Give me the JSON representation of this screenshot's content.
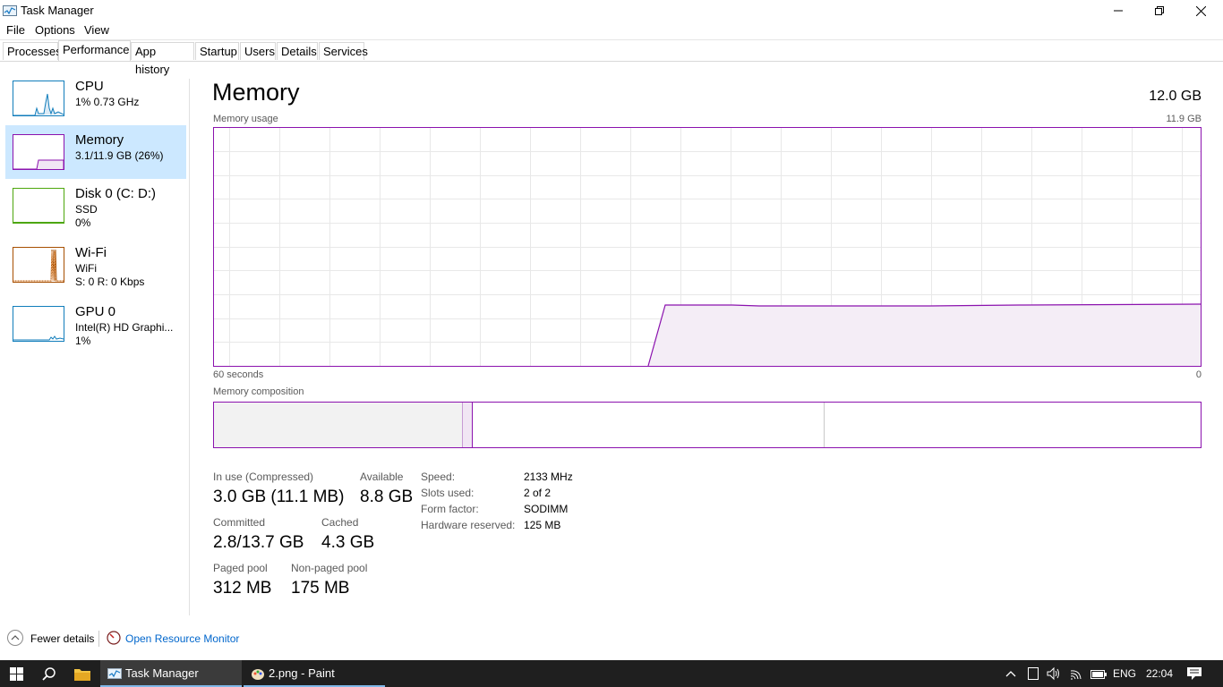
{
  "window": {
    "title": "Task Manager"
  },
  "menu": {
    "items": [
      "File",
      "Options",
      "View"
    ]
  },
  "tabs": [
    {
      "label": "Processes"
    },
    {
      "label": "Performance"
    },
    {
      "label": "App history"
    },
    {
      "label": "Startup"
    },
    {
      "label": "Users"
    },
    {
      "label": "Details"
    },
    {
      "label": "Services"
    }
  ],
  "sidebar": {
    "cpu": {
      "title": "CPU",
      "line1": "1% 0.73 GHz"
    },
    "memory": {
      "title": "Memory",
      "line1": "3.1/11.9 GB (26%)"
    },
    "disk": {
      "title": "Disk 0 (C: D:)",
      "line1": "SSD",
      "line2": "0%"
    },
    "wifi": {
      "title": "Wi-Fi",
      "line1": "WiFi",
      "line2": "S: 0 R: 0 Kbps"
    },
    "gpu": {
      "title": "GPU 0",
      "line1": "Intel(R) HD Graphi...",
      "line2": "1%"
    }
  },
  "main": {
    "title": "Memory",
    "total": "12.0 GB",
    "usage_label": "Memory usage",
    "usage_max": "11.9 GB",
    "time_left": "60 seconds",
    "time_right": "0",
    "composition_label": "Memory composition",
    "stats": {
      "in_use_label": "In use (Compressed)",
      "in_use_value": "3.0 GB (11.1 MB)",
      "available_label": "Available",
      "available_value": "8.8 GB",
      "committed_label": "Committed",
      "committed_value": "2.8/13.7 GB",
      "cached_label": "Cached",
      "cached_value": "4.3 GB",
      "paged_label": "Paged pool",
      "paged_value": "312 MB",
      "nonpaged_label": "Non-paged pool",
      "nonpaged_value": "175 MB"
    },
    "props": {
      "speed_label": "Speed:",
      "speed_value": "2133 MHz",
      "slots_label": "Slots used:",
      "slots_value": "2 of 2",
      "form_label": "Form factor:",
      "form_value": "SODIMM",
      "reserved_label": "Hardware reserved:",
      "reserved_value": "125 MB"
    }
  },
  "footer": {
    "fewer_details": "Fewer details",
    "open_monitor": "Open Resource Monitor"
  },
  "taskbar": {
    "task1": "Task Manager",
    "task2": "2.png - Paint",
    "lang": "ENG",
    "time": "22:04"
  },
  "colors": {
    "memory_accent": "#8b12ae",
    "cpu_accent": "#117dbb",
    "disk_accent": "#4da60c",
    "wifi_accent": "#a74f01",
    "selected_bg": "#cce8ff",
    "link": "#0066cc"
  }
}
